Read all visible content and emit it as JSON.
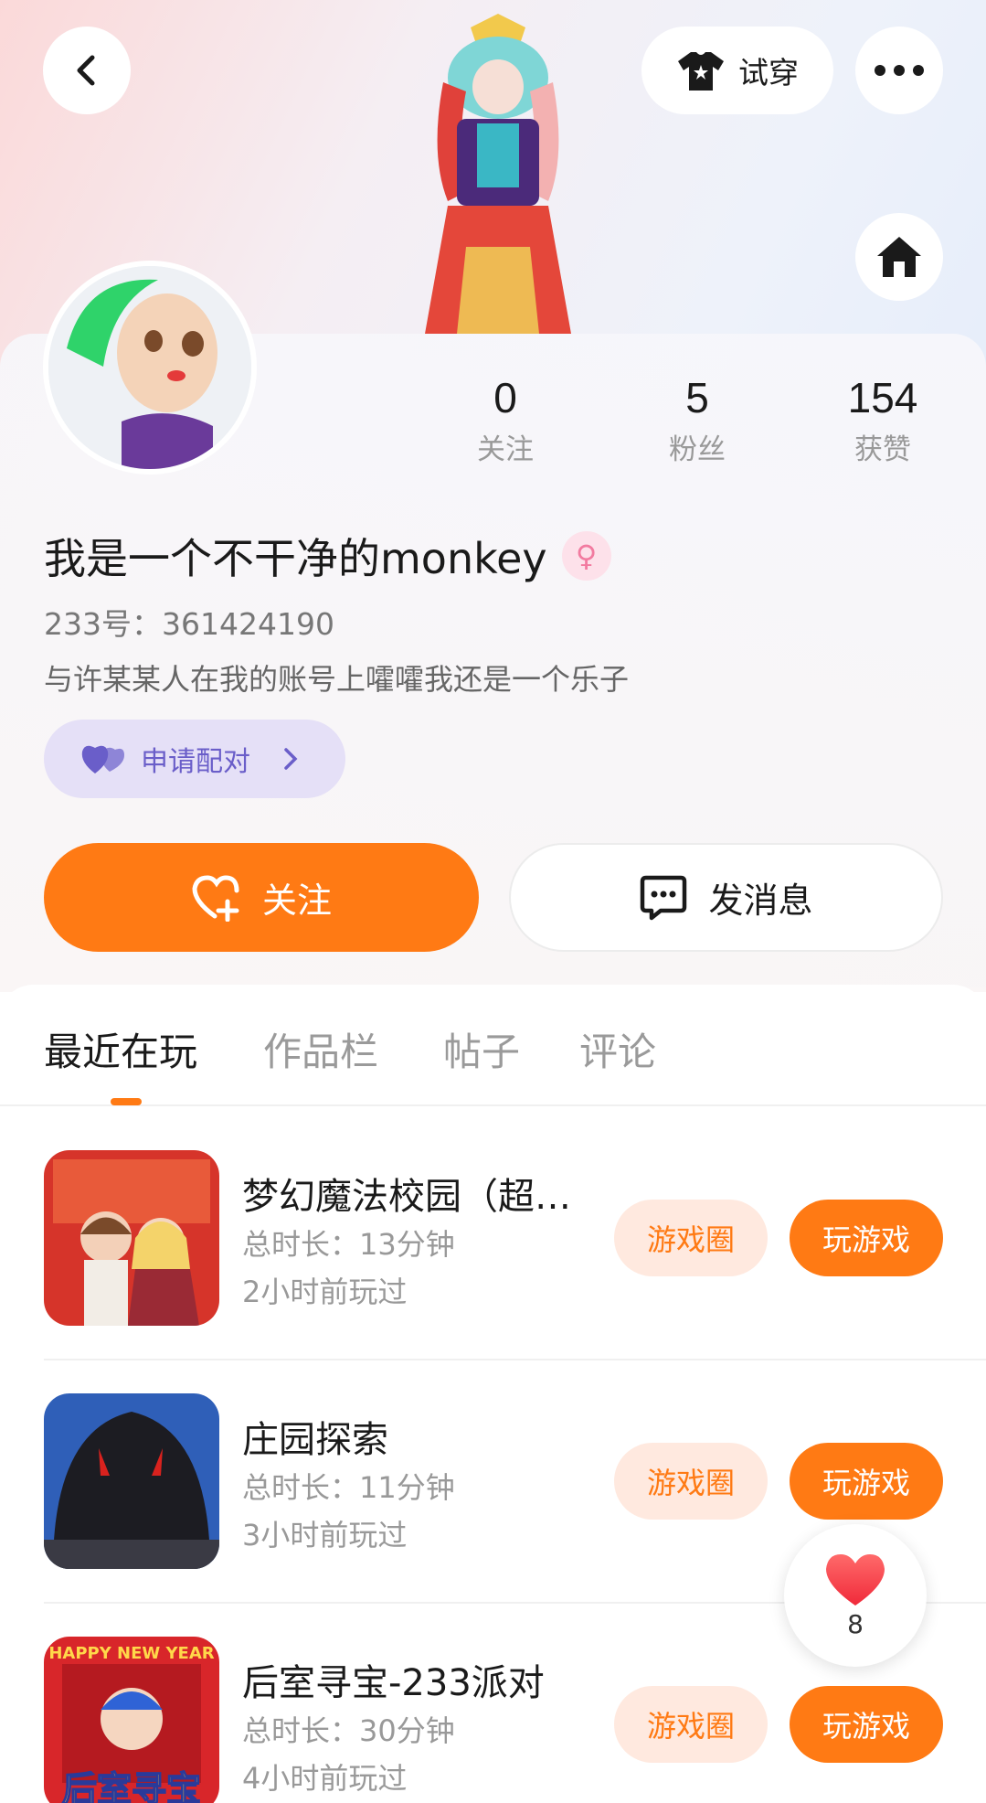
{
  "header": {
    "tryon_label": "试穿"
  },
  "profile": {
    "username": "我是一个不干净的monkey",
    "gender_symbol": "♀",
    "id_label": "233号：361424190",
    "bio": "与许某某人在我的账号上嚯嚯我还是一个乐子",
    "match_label": "申请配对",
    "stats": [
      {
        "value": "0",
        "label": "关注"
      },
      {
        "value": "5",
        "label": "粉丝"
      },
      {
        "value": "154",
        "label": "获赞"
      }
    ]
  },
  "actions": {
    "follow_label": "关注",
    "message_label": "发消息"
  },
  "tabs": [
    "最近在玩",
    "作品栏",
    "帖子",
    "评论"
  ],
  "games": [
    {
      "title": "梦幻魔法校园（超…",
      "duration": "总时长：13分钟",
      "last_played": "2小时前玩过",
      "circle_label": "游戏圈",
      "play_label": "玩游戏"
    },
    {
      "title": "庄园探索",
      "duration": "总时长：11分钟",
      "last_played": "3小时前玩过",
      "circle_label": "游戏圈",
      "play_label": "玩游戏"
    },
    {
      "title": "后室寻宝-233派对",
      "duration": "总时长：30分钟",
      "last_played": "4小时前玩过",
      "circle_label": "游戏圈",
      "play_label": "玩游戏",
      "icon_text_top": "HAPPY NEW YEAR",
      "icon_text_bottom": "后室寻宝"
    }
  ],
  "like_float": {
    "count": "8"
  },
  "colors": {
    "accent": "#ff7a14",
    "chip_bg": "#ffe9df",
    "match_bg": "#e5e0f7",
    "match_text": "#6a5ec9"
  }
}
